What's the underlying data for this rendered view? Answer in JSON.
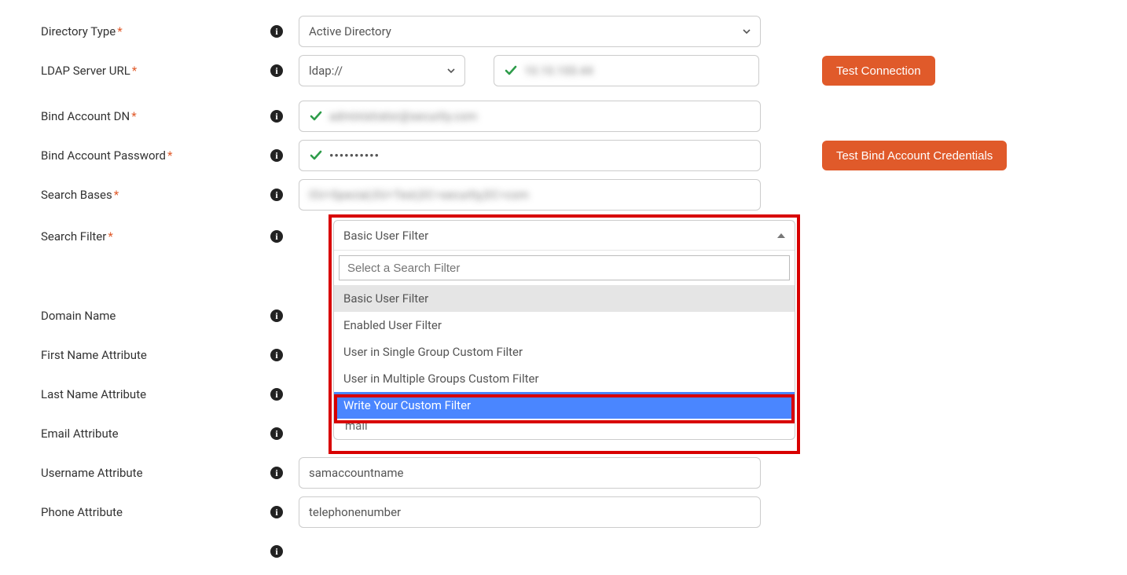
{
  "labels": {
    "directory_type": "Directory Type",
    "ldap_server_url": "LDAP Server URL",
    "bind_dn": "Bind Account DN",
    "bind_pw": "Bind Account Password",
    "search_bases": "Search Bases",
    "search_filter": "Search Filter",
    "domain_name": "Domain Name",
    "first_name_attr": "First Name Attribute",
    "last_name_attr": "Last Name Attribute",
    "email_attr": "Email Attribute",
    "username_attr": "Username Attribute",
    "phone_attr": "Phone Attribute"
  },
  "values": {
    "directory_type": "Active Directory",
    "ldap_protocol": "ldap://",
    "ldap_host_blur": "10.10.100.44",
    "bind_dn_blur": "administrator@security.com",
    "bind_pw_mask": "••••••••••",
    "search_bases_blur": "OU=Special,OU=Test,DC=security,DC=com",
    "email_attr": "mail",
    "username_attr": "samaccountname",
    "phone_attr": "telephonenumber"
  },
  "buttons": {
    "test_connection": "Test Connection",
    "test_bind": "Test Bind Account Credentials"
  },
  "dropdown": {
    "selected": "Basic User Filter",
    "search_placeholder": "Select a Search Filter",
    "options": [
      "Basic User Filter",
      "Enabled User Filter",
      "User in Single Group Custom Filter",
      "User in Multiple Groups Custom Filter",
      "Write Your Custom Filter"
    ],
    "highlighted_index": 4,
    "selected_index": 0,
    "tail_text": "mail"
  }
}
